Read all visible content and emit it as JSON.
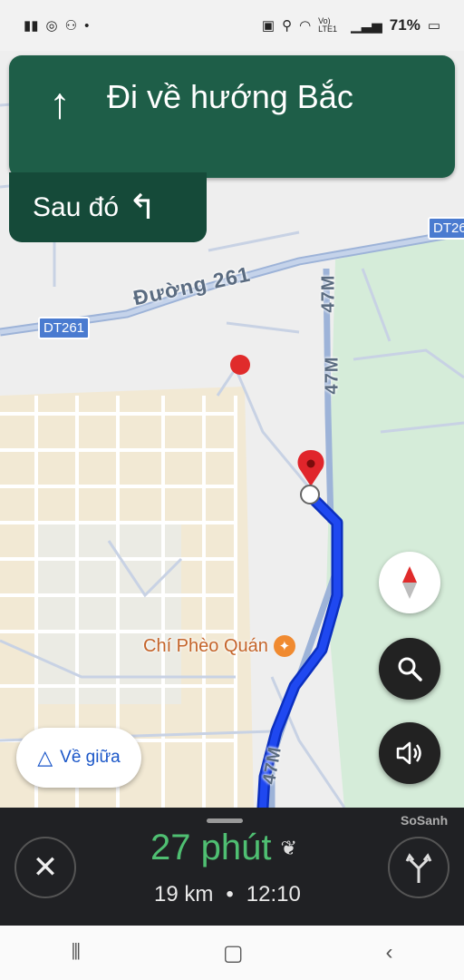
{
  "status_bar": {
    "left_icons": [
      "signal-bars-icon",
      "notification-icon",
      "notification-icon",
      "notification-icon"
    ],
    "lte_label": "Vo) LTE1",
    "battery": "71%"
  },
  "directions": {
    "instruction": "Đi về hướng Bắc",
    "then_label": "Sau đó"
  },
  "map": {
    "road_labels": [
      "DT261",
      "DT26"
    ],
    "street_label": "Đường 261",
    "highway_labels": [
      "47M",
      "47M",
      "47M"
    ],
    "poi_name": "Chí Phèo Quán"
  },
  "controls": {
    "recenter_label": "Về giữa"
  },
  "trip": {
    "duration": "27 phút",
    "distance": "19 km",
    "separator": "•",
    "arrival_time": "12:10"
  },
  "watermark": "SoSanh",
  "colors": {
    "banner": "#1e5e48",
    "route": "#1a3bd8",
    "eta_green": "#4fbf72",
    "pin_red": "#e0252b"
  }
}
